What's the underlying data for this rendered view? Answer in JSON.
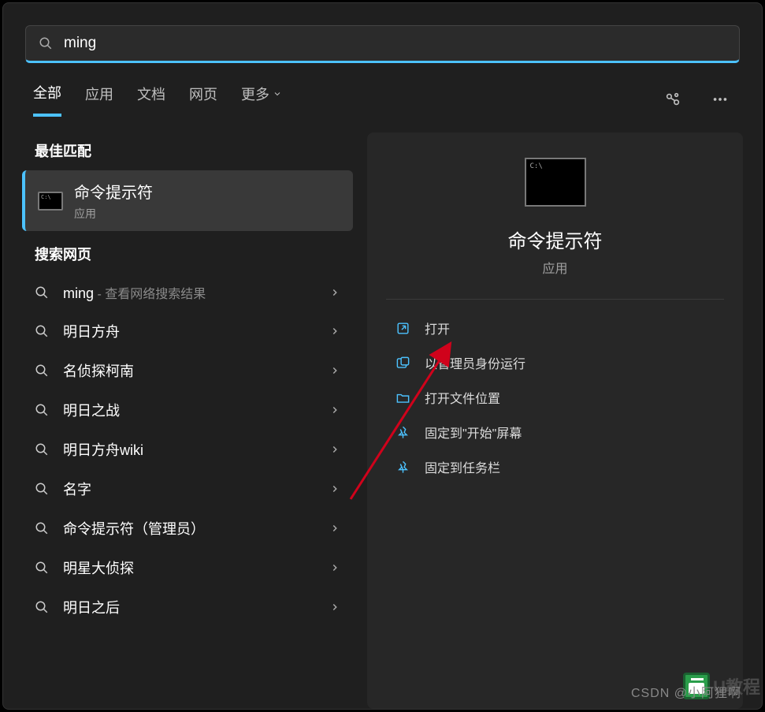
{
  "search": {
    "value": "ming"
  },
  "tabs": {
    "all": "全部",
    "apps": "应用",
    "docs": "文档",
    "web": "网页",
    "more": "更多"
  },
  "left": {
    "best_match_title": "最佳匹配",
    "best_match": {
      "title": "命令提示符",
      "sub": "应用"
    },
    "web_title": "搜索网页",
    "items": [
      {
        "text": "ming",
        "sub": " - 查看网络搜索结果"
      },
      {
        "text": "明日方舟",
        "sub": ""
      },
      {
        "text": "名侦探柯南",
        "sub": ""
      },
      {
        "text": "明日之战",
        "sub": ""
      },
      {
        "text": "明日方舟wiki",
        "sub": ""
      },
      {
        "text": "名字",
        "sub": ""
      },
      {
        "text": "命令提示符（管理员）",
        "sub": ""
      },
      {
        "text": "明星大侦探",
        "sub": ""
      },
      {
        "text": "明日之后",
        "sub": ""
      }
    ]
  },
  "preview": {
    "title": "命令提示符",
    "sub": "应用",
    "actions": [
      {
        "icon": "open",
        "label": "打开"
      },
      {
        "icon": "admin",
        "label": "以管理员身份运行"
      },
      {
        "icon": "folder",
        "label": "打开文件位置"
      },
      {
        "icon": "pin",
        "label": "固定到\"开始\"屏幕"
      },
      {
        "icon": "pin",
        "label": "固定到任务栏"
      }
    ]
  },
  "watermark": "CSDN @小阿狸啊",
  "logo": "U教程"
}
